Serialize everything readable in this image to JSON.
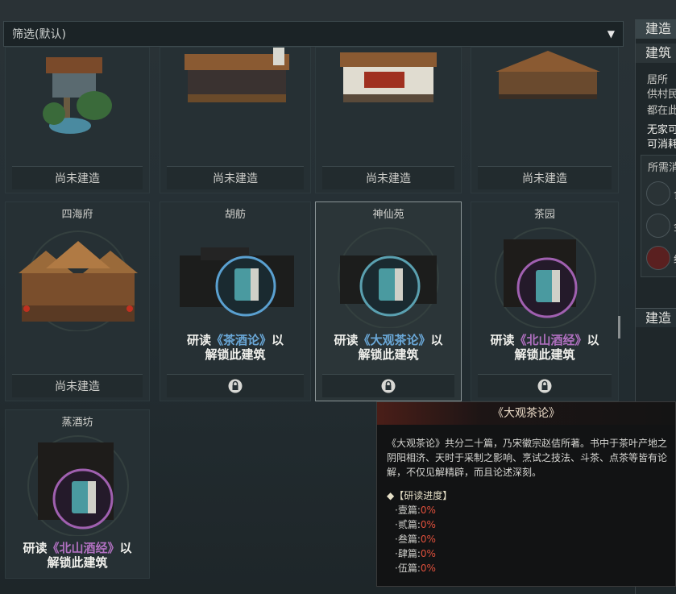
{
  "filter": {
    "label": "筛选(默认)"
  },
  "cards_row1": [
    {
      "status": "尚未建造"
    },
    {
      "status": "尚未建造"
    },
    {
      "status": "尚未建造"
    },
    {
      "status": "尚未建造"
    }
  ],
  "cards_row2": [
    {
      "name": "四海府",
      "status": "尚未建造"
    },
    {
      "name": "胡舫",
      "unlock_pre": "研读",
      "book": "《茶酒论》",
      "unlock_post": "以",
      "unlock_line2": "解锁此建筑",
      "book_color": "#6aa8d8"
    },
    {
      "name": "神仙苑",
      "unlock_pre": "研读",
      "book": "《大观茶论》",
      "unlock_post": "以",
      "unlock_line2": "解锁此建筑",
      "book_color": "#6aa8d8"
    },
    {
      "name": "茶园",
      "unlock_pre": "研读",
      "book": "《北山酒经》",
      "unlock_post": "以",
      "unlock_line2": "解锁此建筑",
      "book_color": "#b070c0"
    }
  ],
  "cards_row3": [
    {
      "name": "蒸酒坊",
      "unlock_pre": "研读",
      "book": "《北山酒经》",
      "unlock_post": "以",
      "unlock_line2": "解锁此建筑",
      "book_color": "#b070c0"
    }
  ],
  "right_panel": {
    "header1": "建造",
    "header2": "建筑",
    "line1": "居所",
    "line2": "供村民",
    "line3": "都在此",
    "line4": "无家可",
    "line5": "可消耗",
    "needs_header": "所需消",
    "res1": "食",
    "res2": "金",
    "res3": "纪",
    "build_button": "建造"
  },
  "tooltip": {
    "title": "《大观茶论》",
    "description": "《大观茶论》共分二十篇，乃宋徽宗赵佶所著。书中于茶叶产地之阴阳相济、天时于采制之影响、烹试之技法、斗茶、点茶等皆有论解，不仅见解精辟，而且论述深刻。",
    "progress_header": "◆【研读进度】",
    "progress": [
      {
        "label": "·壹篇:",
        "value": "0%"
      },
      {
        "label": "·贰篇:",
        "value": "0%"
      },
      {
        "label": "·叁篇:",
        "value": "0%"
      },
      {
        "label": "·肆篇:",
        "value": "0%"
      },
      {
        "label": "·伍篇:",
        "value": "0%"
      }
    ]
  },
  "colors": {
    "accent_blue": "#6aa8d8",
    "accent_purple": "#b070c0",
    "progress_red": "#e0503c"
  }
}
